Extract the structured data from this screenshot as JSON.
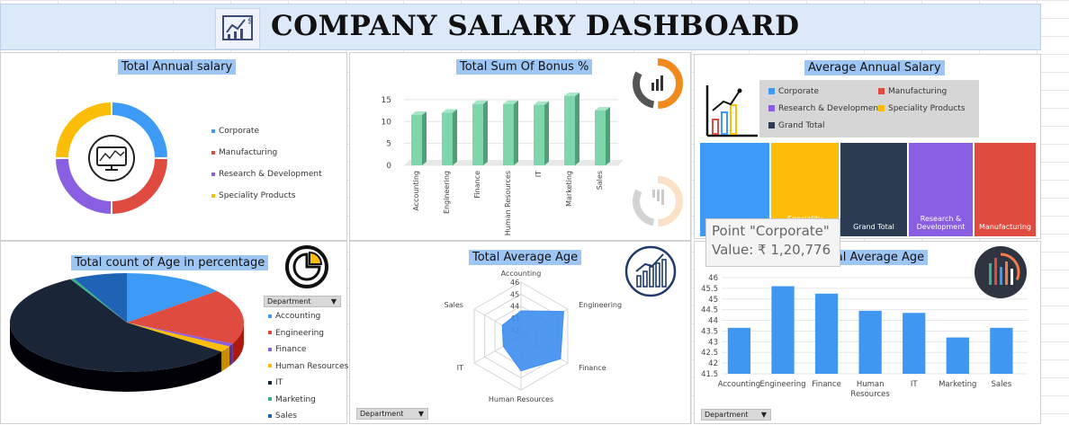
{
  "header": {
    "title": "COMPANY SALARY DASHBOARD"
  },
  "colors": {
    "corporate": "#3d9bf5",
    "manufacturing": "#e04b3f",
    "research": "#8a5ee0",
    "speciality": "#fbbd08",
    "grand_total": "#2b3b52",
    "it": "#1b2538",
    "marketing": "#3bb38a",
    "sales": "#1f63b5",
    "teal": "#7fd6ad",
    "bar_blue": "#3f97f2"
  },
  "panels": {
    "annual_salary": {
      "title": "Total Annual salary"
    },
    "bonus": {
      "title": "Total Sum Of Bonus %"
    },
    "avg_salary": {
      "title": "Average Annual Salary"
    },
    "age_pct": {
      "title": "Total count of Age in percentage"
    },
    "avg_age_radar": {
      "title": "Total Average Age"
    },
    "avg_age_bar": {
      "title": "Total Average Age"
    }
  },
  "tooltip": {
    "line1": "Point \"Corporate\"",
    "line2": "Value: ₹ 1,20,776"
  },
  "filters": {
    "age_pct": "Department",
    "radar": "Department",
    "bar": "Department"
  },
  "chart_data": [
    {
      "id": "annual_salary",
      "type": "pie",
      "title": "Total Annual salary",
      "labels": [
        "Corporate",
        "Manufacturing",
        "Research & Development",
        "Speciality Products"
      ],
      "values": [
        25,
        25,
        25,
        25
      ]
    },
    {
      "id": "bonus",
      "type": "bar",
      "title": "Total Sum Of Bonus %",
      "categories": [
        "Accounting",
        "Engineering",
        "Finance",
        "Human Resources",
        "IT",
        "Marketing",
        "Sales"
      ],
      "values": [
        11.5,
        12,
        14,
        14,
        13.8,
        15.8,
        12.5
      ],
      "yticks": [
        "0",
        "5",
        "10",
        "15"
      ],
      "ylim": [
        0,
        16
      ]
    },
    {
      "id": "avg_salary",
      "type": "heatmap",
      "title": "Average Annual Salary",
      "legend": [
        "Corporate",
        "Manufacturing",
        "Research & Development",
        "Speciality Products",
        "Grand Total"
      ],
      "cells": [
        "Corporate",
        "Speciality Products",
        "Grand Total",
        "Research & Development",
        "Manufacturing"
      ]
    },
    {
      "id": "age_pct",
      "type": "pie",
      "title": "Total count of Age in percentage",
      "labels": [
        "Accounting",
        "Engineering",
        "Finance",
        "Human Resources",
        "IT",
        "Marketing",
        "Sales"
      ],
      "values": [
        14,
        18,
        1,
        2,
        57,
        0.5,
        7.5
      ]
    },
    {
      "id": "avg_age_radar",
      "type": "line",
      "title": "Total Average Age",
      "categories": [
        "Accounting",
        "Engineering",
        "Finance",
        "Human Resources",
        "IT",
        "Sales"
      ],
      "values": [
        43.6,
        45.6,
        45.3,
        44.4,
        43.2,
        43.3
      ],
      "rticks": [
        "42",
        "43",
        "44",
        "45",
        "46"
      ],
      "rlim": [
        41.5,
        46
      ]
    },
    {
      "id": "avg_age_bar",
      "type": "bar",
      "title": "Total Average Age",
      "categories": [
        "Accounting",
        "Engineering",
        "Finance",
        "Human Resources",
        "IT",
        "Marketing",
        "Sales"
      ],
      "values": [
        43.65,
        45.6,
        45.25,
        44.45,
        44.35,
        43.2,
        43.65
      ],
      "yticks": [
        "41.5",
        "42",
        "42.5",
        "43",
        "43.5",
        "44",
        "44.5",
        "45",
        "45.5",
        "46"
      ],
      "ylim": [
        41.5,
        46
      ]
    }
  ]
}
